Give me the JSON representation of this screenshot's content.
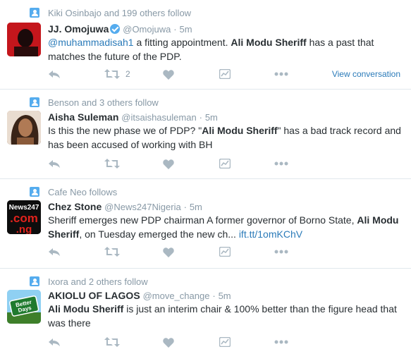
{
  "colors": {
    "link": "#2b7bb9",
    "meta": "#8899a6",
    "icon": "#aab8c2",
    "verified": "#55acee",
    "divider": "#e1e8ed"
  },
  "tweets": [
    {
      "context": "Kiki Osinbajo and 199 others follow",
      "fullname": "JJ. Omojuwa",
      "verified": true,
      "username": "@Omojuwa",
      "dot": "·",
      "time": "5m",
      "body": {
        "mention": "@muhammadisah1",
        "text1": " a fitting appointment. ",
        "bold": "Ali Modu Sheriff",
        "text2": " has a past that matches the future of the PDP."
      },
      "retweet_count": "2",
      "view_conversation": "View conversation"
    },
    {
      "context": "Benson and 3 others follow",
      "fullname": "Aisha Suleman",
      "username": "@itsaishasuleman",
      "dot": "·",
      "time": "5m",
      "body": {
        "text1": "Is this the new phase we of PDP? \"",
        "bold": "Ali Modu Sheriff",
        "text2": "\" has a bad track record and has been accused of working with BH"
      }
    },
    {
      "context": "Cafe Neo follows",
      "fullname": "Chez Stone",
      "username": "@News247Nigeria",
      "dot": "·",
      "time": "5m",
      "avatar_text": "News247 .com .ng",
      "body": {
        "text1": "Sheriff emerges new PDP chairman A former governor of Borno State, ",
        "bold": "Ali Modu Sheriff",
        "text2": ", on Tuesday emerged the new ch... ",
        "link": "ift.tt/1omKChV"
      }
    },
    {
      "context": "Ixora and 2 others follow",
      "fullname": "AKIOLU OF LAGOS",
      "username": "@move_change",
      "dot": "·",
      "time": "5m",
      "avatar_text": "Better Days Just Ahead",
      "body": {
        "bold": "Ali Modu Sheriff",
        "text2": " is just an interim chair & 100% better than the figure head that was there"
      }
    }
  ],
  "icons": {
    "context": "follow-person-icon",
    "reply": "reply-icon",
    "retweet": "retweet-icon",
    "like": "heart-icon",
    "analytics": "analytics-icon",
    "more": "more-dots-icon"
  }
}
